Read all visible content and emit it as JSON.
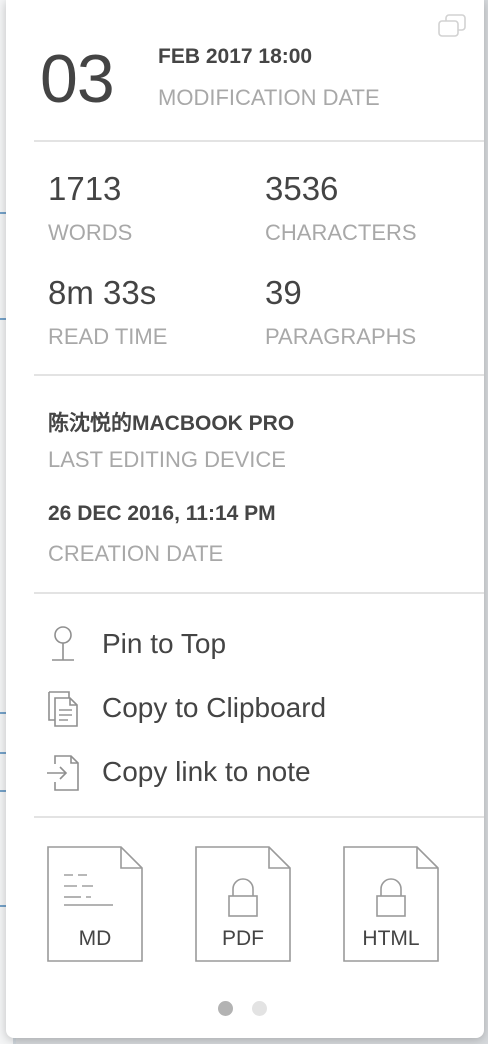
{
  "modification": {
    "day": "03",
    "date_time": "FEB 2017 18:00",
    "label": "MODIFICATION DATE"
  },
  "stats": {
    "words": {
      "value": "1713",
      "label": "WORDS"
    },
    "characters": {
      "value": "3536",
      "label": "CHARACTERS"
    },
    "read_time": {
      "value": "8m 33s",
      "label": "READ TIME"
    },
    "paragraphs": {
      "value": "39",
      "label": "PARAGRAPHS"
    }
  },
  "device": {
    "value": "陈沈悦的MACBOOK PRO",
    "label": "LAST EDITING DEVICE"
  },
  "creation": {
    "value": "26 DEC 2016, 11:14 PM",
    "label": "CREATION DATE"
  },
  "actions": [
    {
      "label": "Pin to Top",
      "icon": "pin-icon"
    },
    {
      "label": "Copy to Clipboard",
      "icon": "clipboard-icon"
    },
    {
      "label": "Copy link to note",
      "icon": "link-note-icon"
    }
  ],
  "exports": [
    {
      "label": "MD",
      "icon": "markdown-file-icon",
      "locked": false
    },
    {
      "label": "PDF",
      "icon": "locked-file-icon",
      "locked": true
    },
    {
      "label": "HTML",
      "icon": "locked-file-icon",
      "locked": true
    }
  ],
  "pager": {
    "pages": 2,
    "current": 1
  },
  "colors": {
    "text": "#444444",
    "muted": "#a8a8a8",
    "divider": "#e3e3e3",
    "dot_active": "#b3b3b3",
    "dot_inactive": "#e3e3e3"
  }
}
